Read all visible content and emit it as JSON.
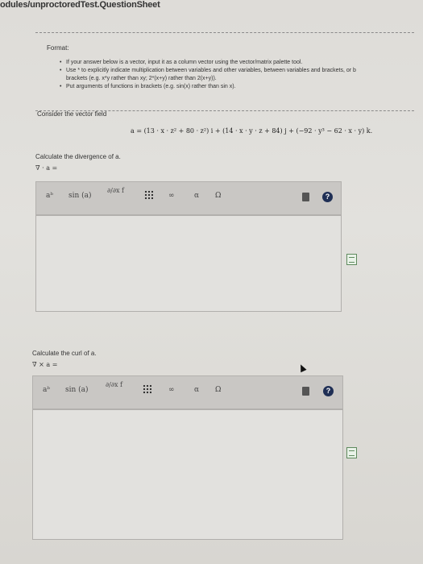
{
  "url_text": "odules/unproctoredTest.QuestionSheet",
  "format": {
    "title": "Format:",
    "bullets": [
      "If your answer below is a vector, input it as a column vector using the vector/matrix palette tool.",
      "Use * to explicitly indicate multiplication between variables and other variables, between variables and brackets, or b",
      "Put arguments of functions in brackets (e.g. sin(x) rather than sin x)."
    ],
    "bullet2_cont": "brackets (e.g. x*y rather than xy; 2*(x+y) rather than 2(x+y))."
  },
  "consider_label": "Consider the vector field",
  "equation": {
    "lhs": "a =",
    "i_part": "(13 · x · z² + 80 · z²)",
    "i_unit": "i +",
    "j_part": "(14 · x · y · z + 84)",
    "j_unit": "j +",
    "k_part": "(−92 · y³ − 62 · x · y)",
    "k_unit": "k."
  },
  "questions": [
    {
      "label": "Calculate the divergence of a.",
      "expression": "∇ · a =",
      "toolbar": {
        "power": "aᵇ",
        "sin": "sin (a)",
        "deriv": "∂/∂x f",
        "infinity": "∞",
        "alpha": "α",
        "omega": "Ω",
        "help": "?"
      }
    },
    {
      "label": "Calculate the curl of a.",
      "expression": "∇ × a =",
      "toolbar": {
        "power": "aᵇ",
        "sin": "sin (a)",
        "deriv": "∂/∂x f",
        "infinity": "∞",
        "alpha": "α",
        "omega": "Ω",
        "help": "?"
      }
    }
  ]
}
